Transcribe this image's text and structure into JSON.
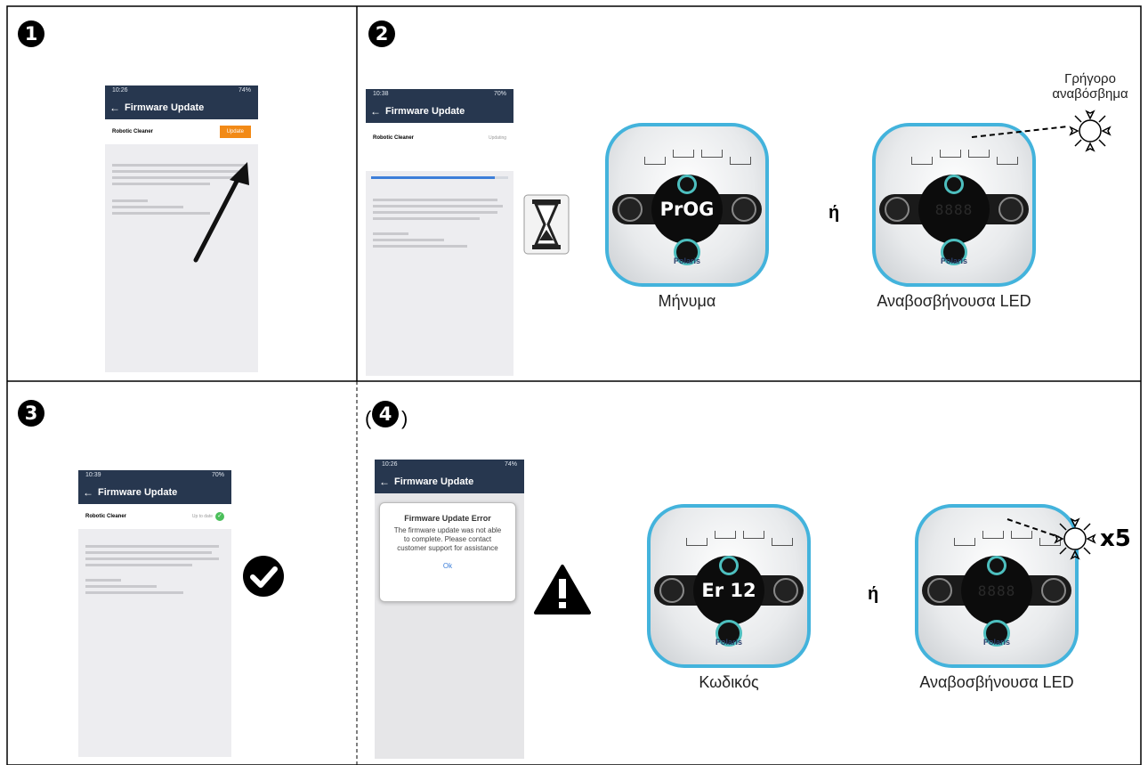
{
  "steps": {
    "s1": "1",
    "s2": "2",
    "s3": "3",
    "s4": "4",
    "paren_open": "(",
    "paren_close": ")"
  },
  "phone": {
    "title": "Firmware Update",
    "device": "Robotic Cleaner",
    "status_1": "10:26",
    "status_2": "10:38",
    "status_3": "10:39",
    "status_4": "10:26",
    "battery_1": "74%",
    "battery_2": "70%",
    "battery_3": "70%",
    "battery_4": "74%",
    "update_button": "Update",
    "updating_label": "Updating",
    "uptodate_label": "Up to date",
    "progress_percent": 90
  },
  "error_dialog": {
    "title": "Firmware Update Error",
    "body": "The firmware update was not able to complete. Please contact customer support for assistance",
    "ok": "Ok"
  },
  "panels": {
    "prog_text": "PrOG",
    "err_text": "Er 12",
    "brand": "Polaris",
    "caption_message": "Μήνυμα",
    "caption_led": "Αναβοσβήνουσα LED",
    "caption_code": "Κωδικός",
    "caption_led_2": "Αναβοσβήνουσα LED",
    "or": "ή",
    "or_2": "ή",
    "fast_blink_1": "Γρήγορο",
    "fast_blink_2": "αναβόσβημα",
    "times": "x5"
  },
  "icons": {
    "hourglass": "hourglass-icon",
    "check": "check-circle-icon",
    "warning": "warning-triangle-icon",
    "arrow": "pointer-arrow-icon",
    "blink": "blinking-sun-icon"
  }
}
